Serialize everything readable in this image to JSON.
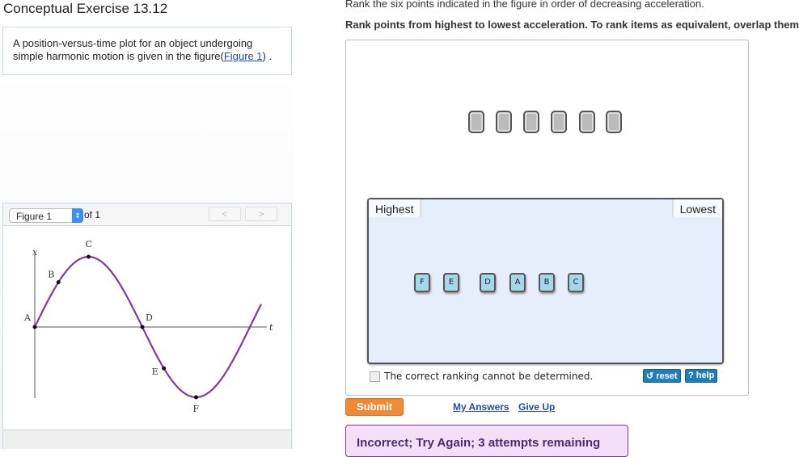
{
  "title": "Conceptual Exercise 13.12",
  "intro": {
    "text": "A position-versus-time plot for an object undergoing simple harmonic motion is given in the figure(",
    "link": "Figure 1",
    "after": ") ."
  },
  "figure": {
    "selected": "Figure 1",
    "of": "of 1",
    "prev": "<",
    "next": ">",
    "axis_x": "x",
    "axis_t": "t",
    "points": [
      "A",
      "B",
      "C",
      "D",
      "E",
      "F"
    ]
  },
  "question": {
    "line1": "Rank the six points indicated in the figure in order of decreasing acceleration.",
    "line2": "Rank points from highest to lowest acceleration. To rank items as equivalent, overlap them."
  },
  "ranking": {
    "highest": "Highest",
    "lowest": "Lowest",
    "tiles": [
      "F",
      "E",
      "D",
      "A",
      "B",
      "C"
    ],
    "checkbox_label": "The correct ranking cannot be determined.",
    "checked": false,
    "reset": "↺ reset",
    "help": "? help"
  },
  "actions": {
    "submit": "Submit",
    "my_answers": "My Answers",
    "give_up": "Give Up"
  },
  "feedback": "Incorrect; Try Again; 3 attempts remaining"
}
